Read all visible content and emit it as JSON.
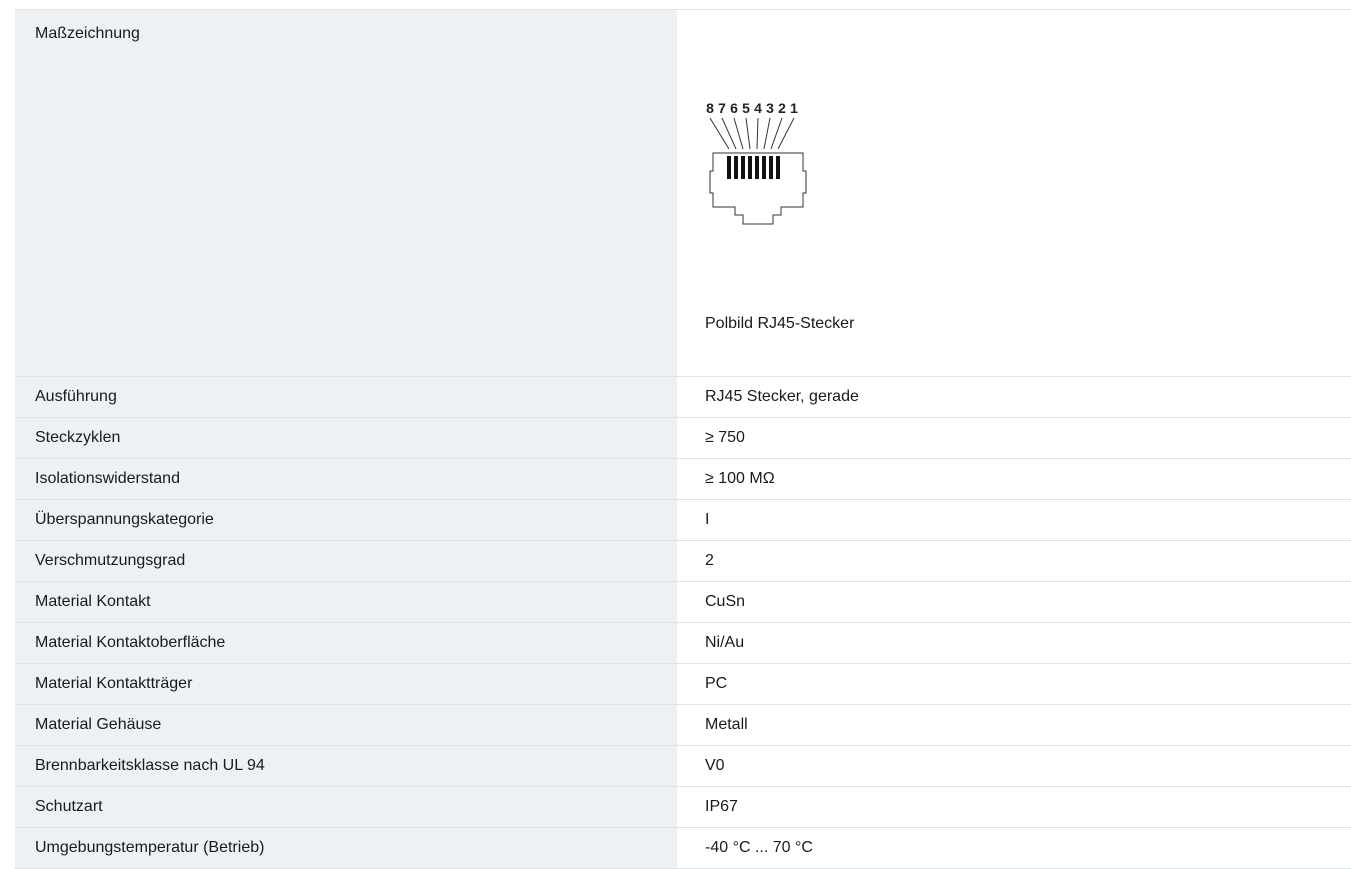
{
  "drawing": {
    "label": "Maßzeichnung",
    "pin_numbers": [
      "8",
      "7",
      "6",
      "5",
      "4",
      "3",
      "2",
      "1"
    ],
    "caption": "Polbild RJ45-Stecker"
  },
  "specs": [
    {
      "label": "Ausführung",
      "value": "RJ45 Stecker, gerade"
    },
    {
      "label": "Steckzyklen",
      "value": "≥ 750"
    },
    {
      "label": "Isolationswiderstand",
      "value": "≥ 100 MΩ"
    },
    {
      "label": "Überspannungskategorie",
      "value": "I"
    },
    {
      "label": "Verschmutzungsgrad",
      "value": "2"
    },
    {
      "label": "Material Kontakt",
      "value": "CuSn"
    },
    {
      "label": "Material Kontaktoberfläche",
      "value": "Ni/Au"
    },
    {
      "label": "Material Kontaktträger",
      "value": "PC"
    },
    {
      "label": "Material Gehäuse",
      "value": "Metall"
    },
    {
      "label": "Brennbarkeitsklasse nach UL 94",
      "value": "V0"
    },
    {
      "label": "Schutzart",
      "value": "IP67"
    },
    {
      "label": "Umgebungstemperatur (Betrieb)",
      "value": "-40 °C ... 70 °C"
    }
  ]
}
